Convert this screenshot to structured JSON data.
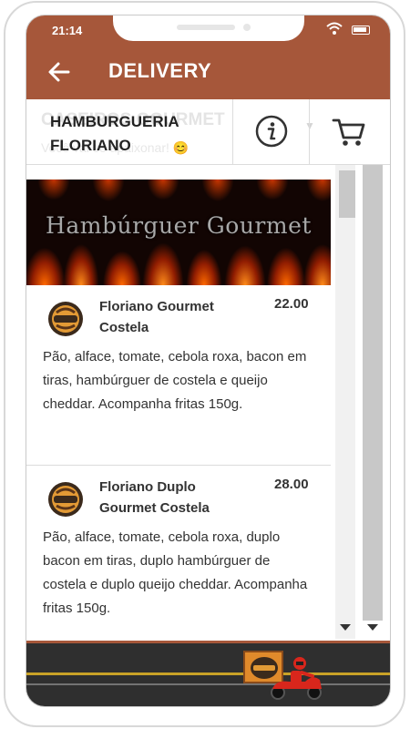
{
  "status_bar": {
    "time": "21:14"
  },
  "app_bar": {
    "title": "DELIVERY"
  },
  "store": {
    "name_line1": "HAMBURGUERIA",
    "name_line2": "FLORIANO",
    "ghost_title": "CASEIROS GOURMET",
    "ghost_subtitle": "Você vai se apaixonar! 😊"
  },
  "banner": {
    "text": "Hambúrguer Gourmet"
  },
  "products": [
    {
      "name": "Floriano Gourmet Costela",
      "price": "22.00",
      "description": "Pão, alface, tomate, cebola roxa, bacon em tiras, hambúrguer de costela e queijo cheddar. Acompanha fritas 150g."
    },
    {
      "name": "Floriano Duplo Gourmet Costela",
      "price": "28.00",
      "description": "Pão, alface, tomate, cebola roxa, duplo bacon em tiras, duplo hambúrguer de costela e duplo queijo cheddar. Acompanha fritas 150g."
    }
  ],
  "icons": {
    "back": "arrow-left-icon",
    "info": "info-icon",
    "cart": "cart-icon",
    "wifi": "wifi-icon",
    "battery": "battery-icon"
  },
  "colors": {
    "brand": "#a6573a",
    "text": "#333333"
  }
}
